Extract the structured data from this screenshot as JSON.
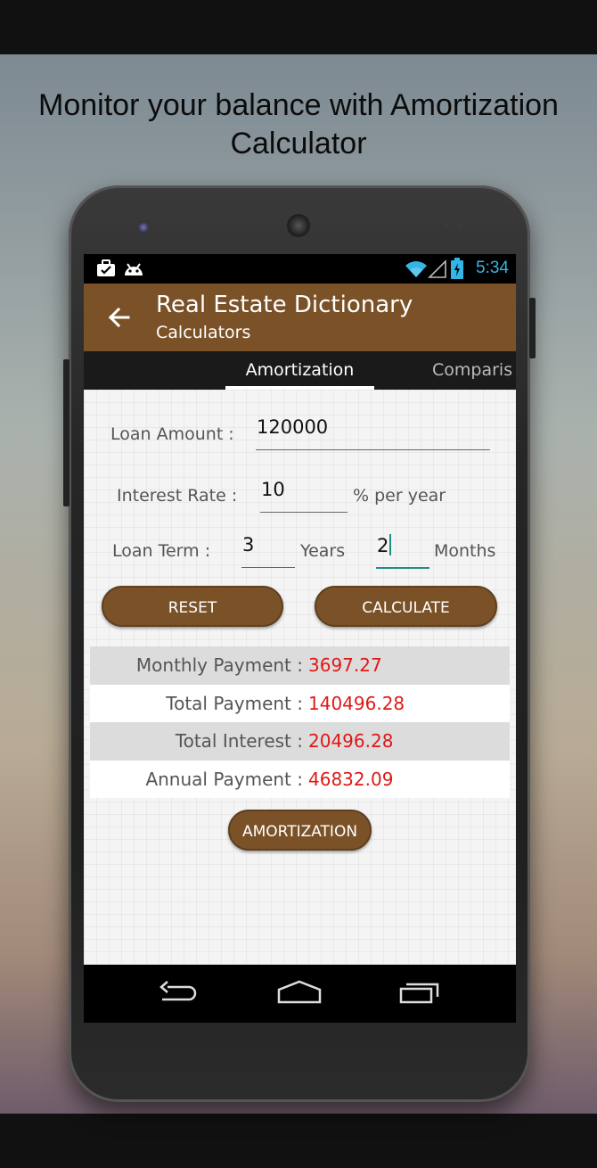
{
  "headline": "Monitor your balance with Amortization Calculator",
  "status_bar": {
    "time": "5:34",
    "left_icons": [
      "briefcase-check-icon",
      "android-icon"
    ],
    "right_icons": [
      "wifi-icon",
      "signal-icon",
      "battery-charging-icon"
    ]
  },
  "app_bar": {
    "title": "Real Estate Dictionary",
    "subtitle": "Calculators",
    "color": "#7b5228"
  },
  "tabs": [
    {
      "label": "Amortization",
      "active": true
    },
    {
      "label": "Comparis",
      "active": false
    }
  ],
  "form": {
    "loan_amount_label": "Loan Amount :",
    "loan_amount_value": "120000",
    "interest_rate_label": "Interest Rate :",
    "interest_rate_value": "10",
    "interest_unit": "% per year",
    "loan_term_label": "Loan Term :",
    "years_value": "3",
    "years_unit": "Years",
    "months_value": "2",
    "months_unit": "Months"
  },
  "buttons": {
    "reset": "RESET",
    "calculate": "CALCULATE",
    "amortization": "AMORTIZATION"
  },
  "results": [
    {
      "label": "Monthly Payment :",
      "value": "3697.27"
    },
    {
      "label": "Total Payment :",
      "value": "140496.28"
    },
    {
      "label": "Total Interest :",
      "value": "20496.28"
    },
    {
      "label": "Annual Payment :",
      "value": "46832.09"
    }
  ],
  "colors": {
    "accent": "#7b5228",
    "result_value": "#e01818",
    "focus": "#1e8f86",
    "status_text": "#33b5e5"
  },
  "nav_bar": [
    "back-icon",
    "home-icon",
    "recents-icon"
  ]
}
